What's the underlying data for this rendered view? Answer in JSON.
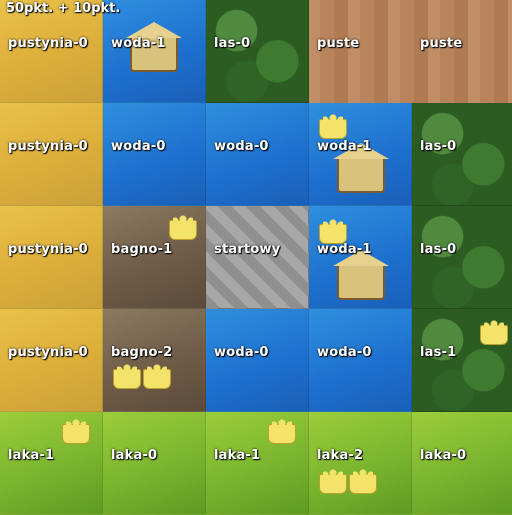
{
  "score": "50pkt. + 10pkt.",
  "grid": [
    [
      "pustynia-0",
      "woda-1",
      "las-0",
      "puste",
      "puste"
    ],
    [
      "pustynia-0",
      "woda-0",
      "woda-0",
      "woda-1",
      "las-0"
    ],
    [
      "pustynia-0",
      "bagno-1",
      "startowy",
      "woda-1",
      "las-0"
    ],
    [
      "pustynia-0",
      "bagno-2",
      "woda-0",
      "woda-0",
      "las-1"
    ],
    [
      "laka-1",
      "laka-0",
      "laka-1",
      "laka-2",
      "laka-0"
    ]
  ],
  "colors": {
    "pustynia": "#dcae3a",
    "woda": "#1d6fcd",
    "las": "#2c5c22",
    "bagno": "#6f5c47",
    "startowy": "#9a9a9a",
    "laka": "#7ab52e"
  },
  "icons": {
    "crown": "crown-icon",
    "hut": "hut-icon"
  }
}
